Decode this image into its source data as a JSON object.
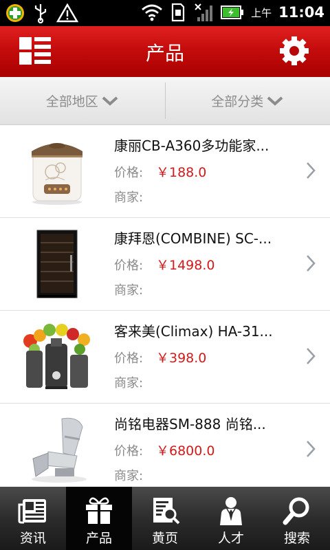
{
  "status_bar": {
    "ampm": "上午",
    "time": "11:04",
    "icons": [
      "plus-app-icon",
      "usb-icon",
      "warning-icon",
      "wifi-icon",
      "sd-card-icon",
      "no-signal-icon",
      "battery-icon"
    ]
  },
  "header": {
    "title": "产品",
    "menu_icon": "list-menu-icon",
    "settings_icon": "gear-icon",
    "color": "#c50c0c"
  },
  "filters": {
    "region": "全部地区",
    "category": "全部分类"
  },
  "products": [
    {
      "name": "康丽CB-A360多功能家...",
      "price_label": "价格:",
      "price": "￥188.0",
      "merchant_label": "商家:",
      "image": "cooker-image"
    },
    {
      "name": "康拜恩(COMBINE) SC-...",
      "price_label": "价格:",
      "price": "￥1498.0",
      "merchant_label": "商家:",
      "image": "wine-cabinet-image"
    },
    {
      "name": "客来美(Climax) HA-31...",
      "price_label": "价格:",
      "price": "￥398.0",
      "merchant_label": "商家:",
      "image": "juicer-image"
    },
    {
      "name": "尚铭电器SM-888 尚铭...",
      "price_label": "价格:",
      "price": "￥6800.0",
      "merchant_label": "商家:",
      "image": "massage-chair-image"
    }
  ],
  "tabs": [
    {
      "label": "资讯",
      "icon": "newspaper-icon",
      "active": false
    },
    {
      "label": "产品",
      "icon": "gift-icon",
      "active": true
    },
    {
      "label": "黄页",
      "icon": "yellow-pages-icon",
      "active": false
    },
    {
      "label": "人才",
      "icon": "person-icon",
      "active": false
    },
    {
      "label": "搜索",
      "icon": "search-icon",
      "active": false
    }
  ],
  "colors": {
    "price": "#d21a1a",
    "header": "#c50c0c"
  }
}
